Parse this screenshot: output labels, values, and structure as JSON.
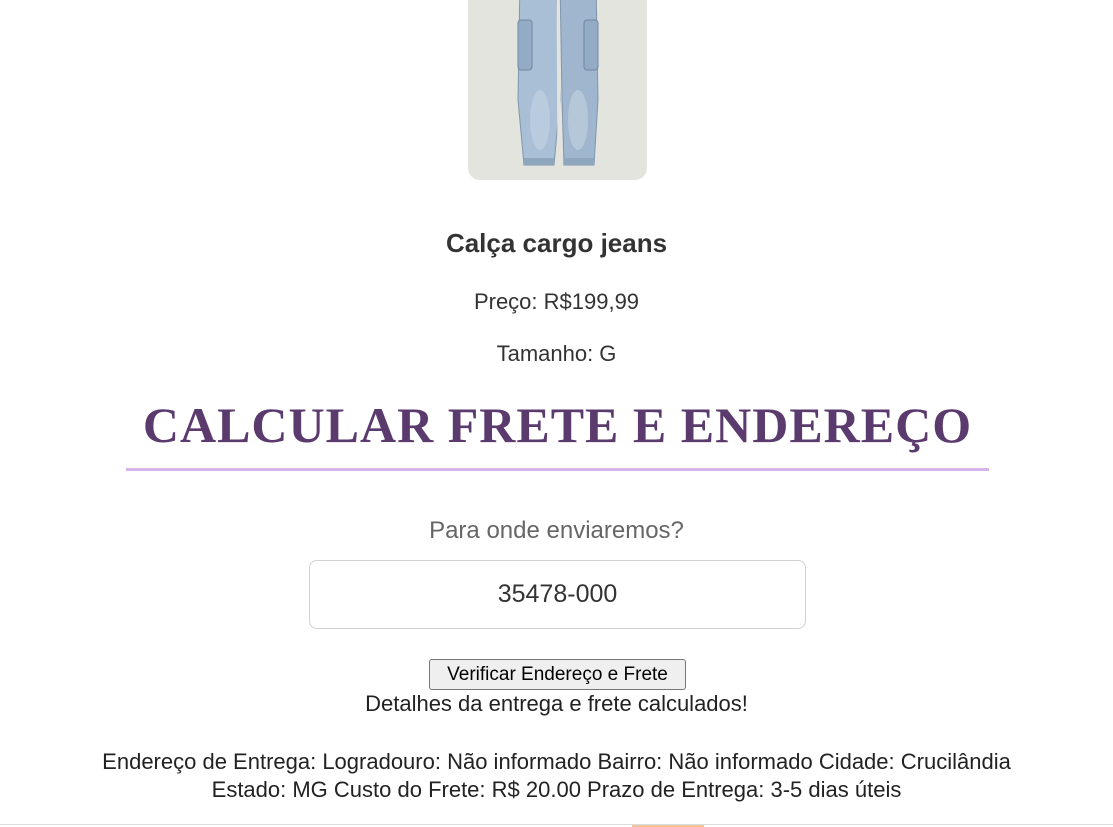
{
  "product": {
    "image_alt_icon": "jeans-photo",
    "name": "Calça cargo jeans",
    "price": "Preço: R$199,99",
    "size": "Tamanho: G"
  },
  "shipping": {
    "title": "CALCULAR FRETE E ENDEREÇO",
    "question": "Para onde enviaremos?",
    "cep_value": "35478-000",
    "verify_button_label": "Verificar Endereço e Frete",
    "status_message": "Detalhes da entrega e frete calculados!",
    "details_line1": "Endereço de Entrega: Logradouro: Não informado Bairro: Não informado Cidade: Crucilândia",
    "details_line2": "Estado: MG Custo do Frete: R$ 20.00 Prazo de Entrega: 3-5 dias úteis"
  },
  "colors": {
    "title": "#5b3a6e",
    "divider": "#d8b4ec",
    "image_bg": "#e4e4df",
    "denim": "#a9bfd6"
  }
}
